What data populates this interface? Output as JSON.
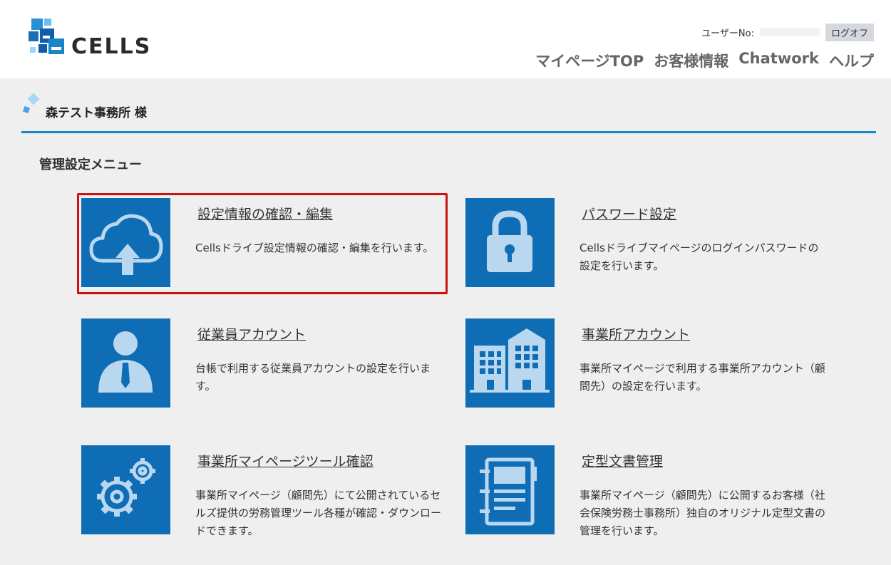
{
  "header": {
    "logo_text": "CELLS",
    "user_no_label": "ユーザーNo:",
    "logoff_label": "ログオフ",
    "nav": [
      {
        "label": "マイページTOP"
      },
      {
        "label": "お客様情報"
      },
      {
        "label": "Chatwork"
      },
      {
        "label": "ヘルプ"
      }
    ]
  },
  "office": {
    "name": "森テスト事務所 様"
  },
  "menu": {
    "title": "管理設定メニュー",
    "items": [
      {
        "icon": "cloud-upload-icon",
        "title": "設定情報の確認・編集",
        "desc": "Cellsドライブ設定情報の確認・編集を行います。",
        "highlighted": true
      },
      {
        "icon": "lock-icon",
        "title": "パスワード設定",
        "desc": "Cellsドライブマイページのログインパスワードの設定を行います。"
      },
      {
        "icon": "employee-icon",
        "title": "従業員アカウント",
        "desc": "台帳で利用する従業員アカウントの設定を行います。"
      },
      {
        "icon": "building-icon",
        "title": "事業所アカウント",
        "desc": "事業所マイページで利用する事業所アカウント（顧問先）の設定を行います。"
      },
      {
        "icon": "gears-icon",
        "title": "事業所マイページツール確認",
        "desc": "事業所マイページ（顧問先）にて公開されているセルズ提供の労務管理ツール各種が確認・ダウンロードできます。"
      },
      {
        "icon": "document-icon",
        "title": "定型文書管理",
        "desc": "事業所マイページ（顧問先）に公開するお客様（社会保険労務士事務所）独自のオリジナル定型文書の管理を行います。"
      }
    ]
  },
  "colors": {
    "tile_blue": "#0f6db5",
    "accent_line": "#1a85c9",
    "highlight_red": "#cc1111"
  }
}
